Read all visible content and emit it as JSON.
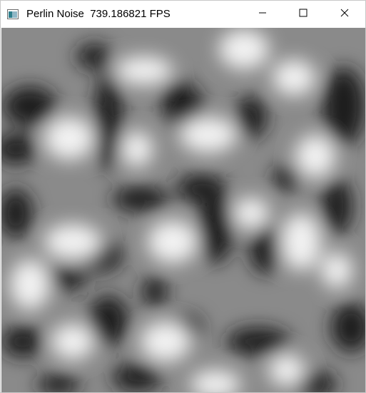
{
  "window": {
    "title": "Perlin Noise  739.186821 FPS",
    "icon": "app-window-icon",
    "controls": {
      "minimize": "minimize-icon",
      "maximize": "maximize-icon",
      "close": "close-icon"
    }
  },
  "canvas": {
    "content": "grayscale perlin noise",
    "colors": {
      "dark": "#1e1e1e",
      "light": "#f2f2f2",
      "mid": "#8a8a8a"
    }
  }
}
